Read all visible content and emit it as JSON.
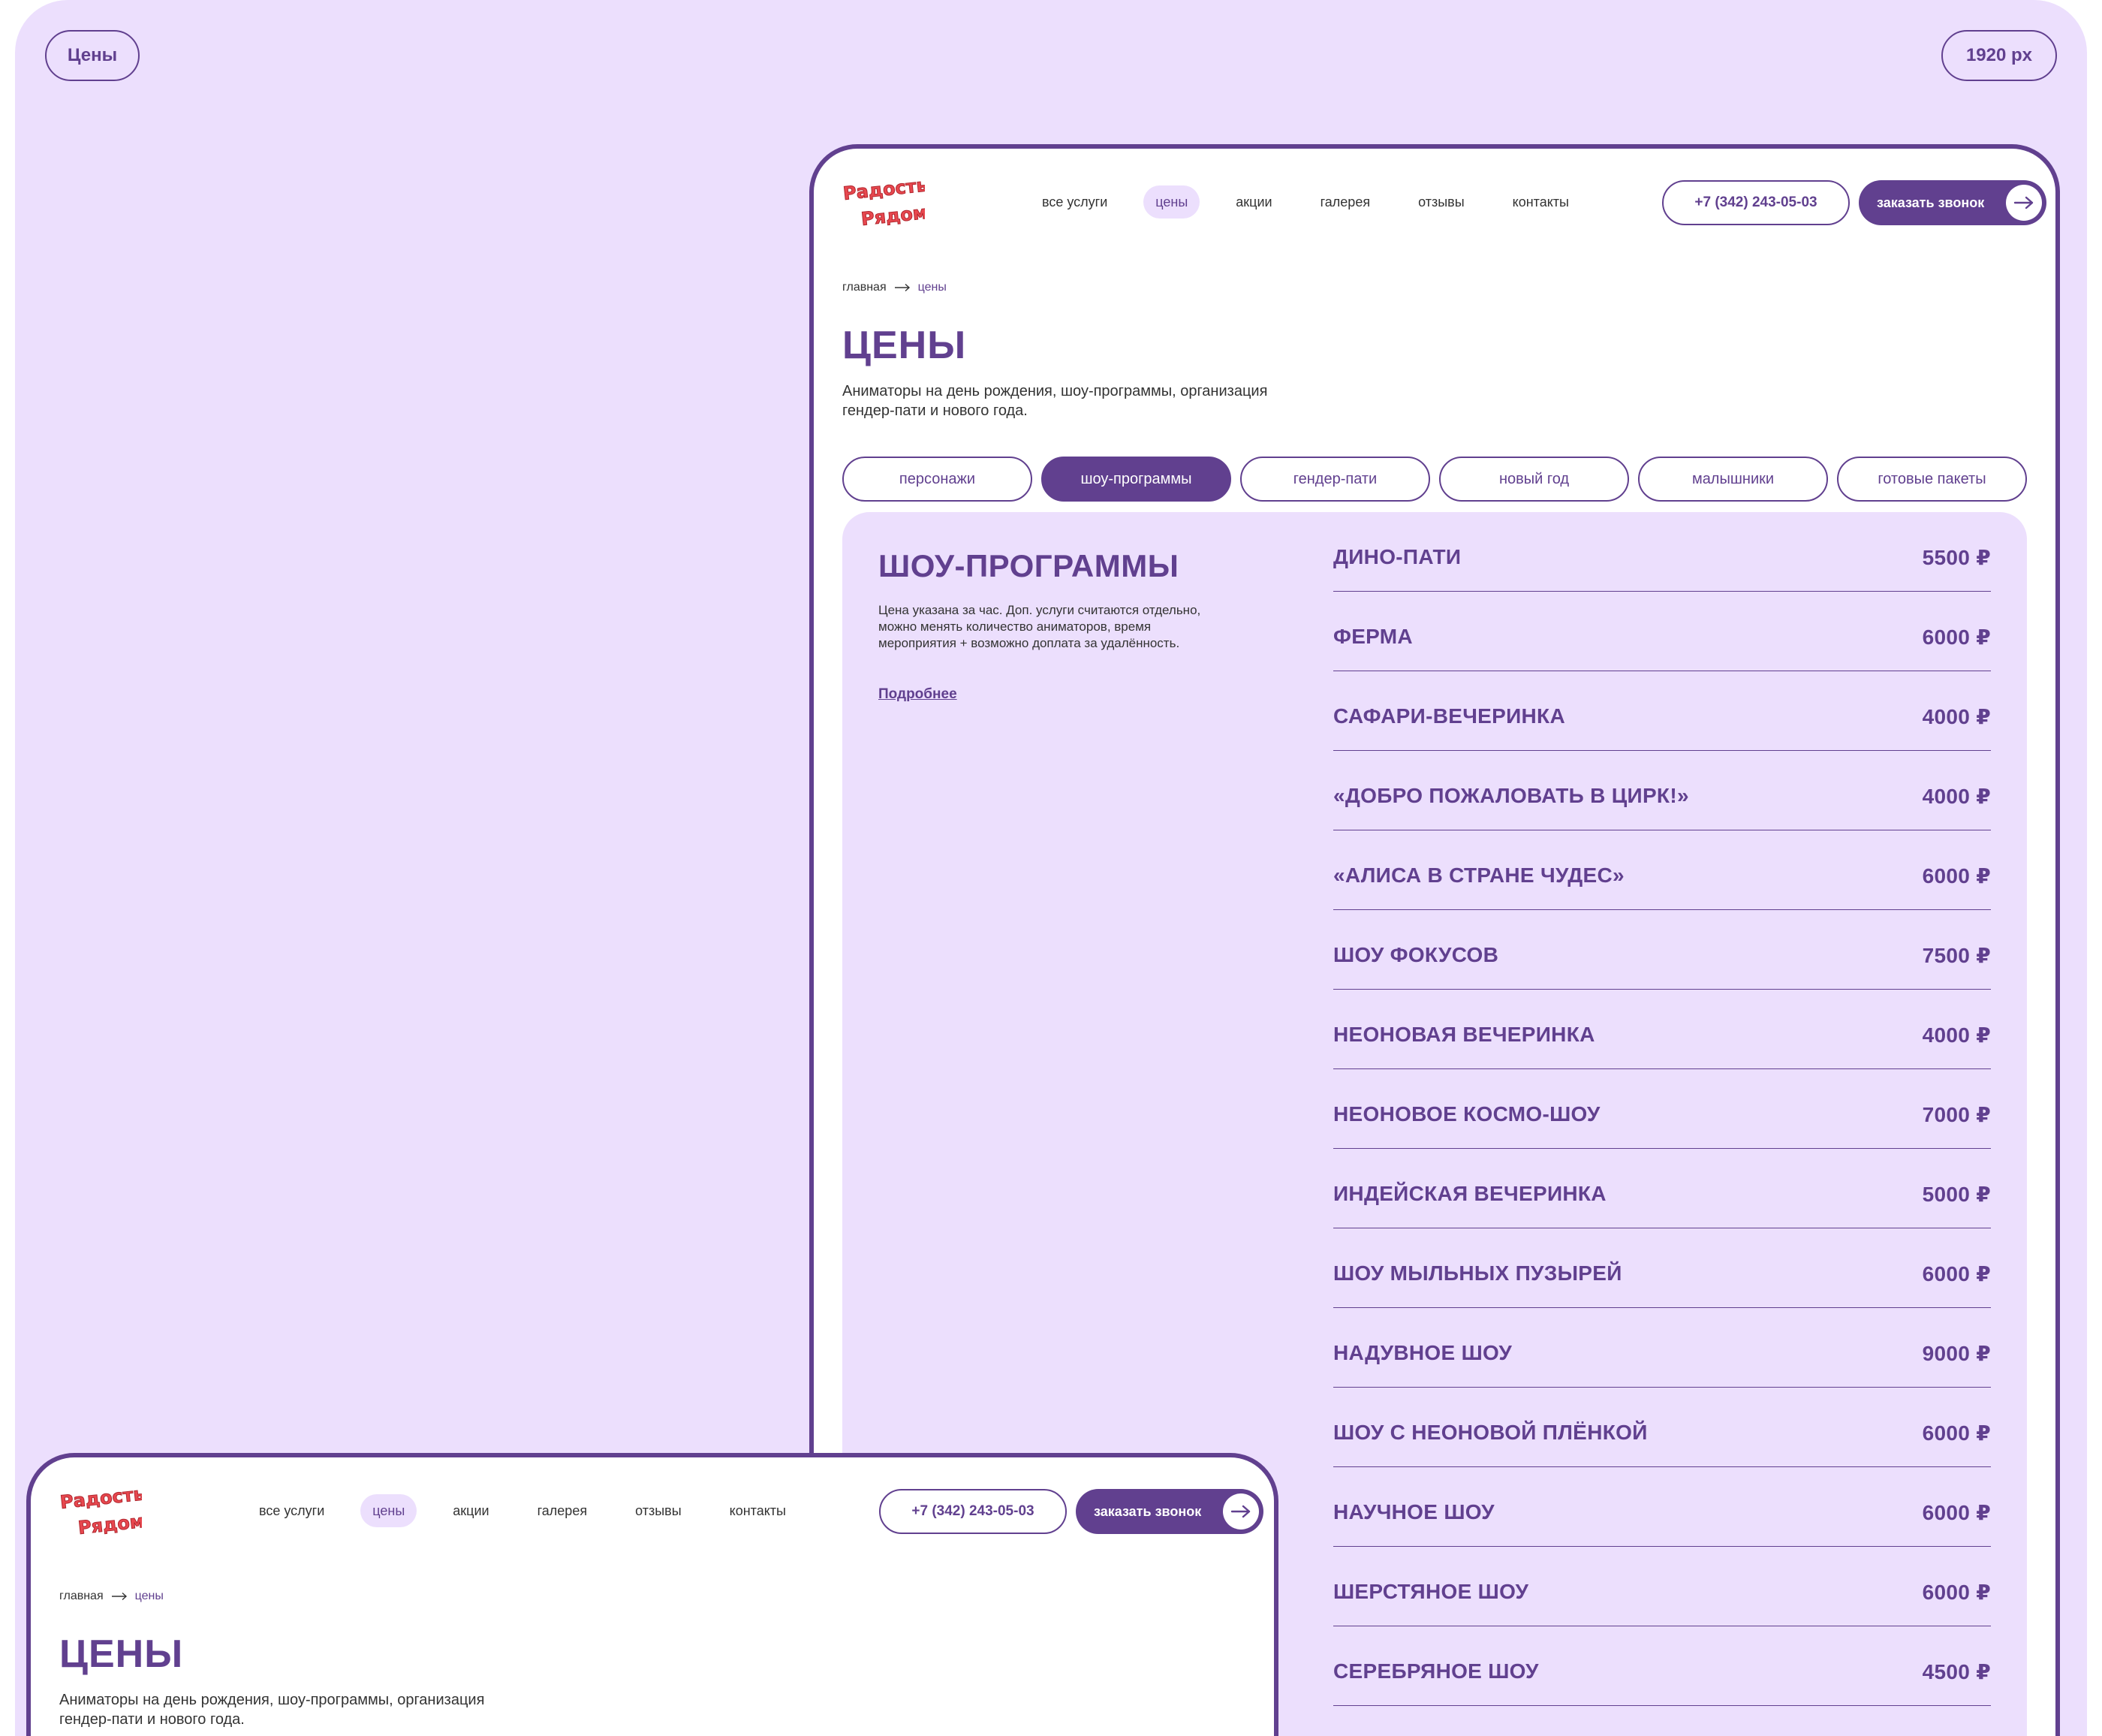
{
  "corner": {
    "left_label": "Цены",
    "right_label": "1920 px"
  },
  "header": {
    "logo_text": "Радость Рядом",
    "nav": [
      "все услуги",
      "цены",
      "акции",
      "галерея",
      "отзывы",
      "контакты"
    ],
    "active_nav": "цены",
    "phone": "+7 (342) 243-05-03",
    "call_label": "заказать звонок"
  },
  "breadcrumb": {
    "home": "главная",
    "current": "цены"
  },
  "page": {
    "title": "ЦЕНЫ",
    "subtitle": "Аниматоры на день рождения, шоу-программы, организация гендер-пати и нового года."
  },
  "tabs": [
    "персонажи",
    "шоу-программы",
    "гендер-пати",
    "новый год",
    "малышники",
    "готовые пакеты"
  ],
  "active_tab": "шоу-программы",
  "panel": {
    "title": "ШОУ-ПРОГРАММЫ",
    "description": "Цена указана за час. Доп. услуги считаются отдельно, можно менять количество аниматоров, время мероприятия + возможно доплата за удалённость.",
    "link": "Подробнее"
  },
  "prices": [
    {
      "name": "ДИНО-ПАТИ",
      "price": "5500 ₽"
    },
    {
      "name": "ФЕРМА",
      "price": "6000 ₽"
    },
    {
      "name": "САФАРИ-ВЕЧЕРИНКА",
      "price": "4000 ₽"
    },
    {
      "name": "«ДОБРО ПОЖАЛОВАТЬ В ЦИРК!»",
      "price": "4000 ₽"
    },
    {
      "name": "«АЛИСА В СТРАНЕ ЧУДЕС»",
      "price": "6000 ₽"
    },
    {
      "name": "ШОУ ФОКУСОВ",
      "price": "7500 ₽"
    },
    {
      "name": "НЕОНОВАЯ ВЕЧЕРИНКА",
      "price": "4000 ₽"
    },
    {
      "name": "НЕОНОВОЕ КОСМО-ШОУ",
      "price": "7000 ₽"
    },
    {
      "name": "ИНДЕЙСКАЯ ВЕЧЕРИНКА",
      "price": "5000 ₽"
    },
    {
      "name": "ШОУ МЫЛЬНЫХ ПУЗЫРЕЙ",
      "price": "6000 ₽"
    },
    {
      "name": "НАДУВНОЕ ШОУ",
      "price": "9000 ₽"
    },
    {
      "name": "ШОУ С НЕОНОВОЙ ПЛЁНКОЙ",
      "price": "6000 ₽"
    },
    {
      "name": "НАУЧНОЕ ШОУ",
      "price": "6000 ₽"
    },
    {
      "name": "ШЕРСТЯНОЕ ШОУ",
      "price": "6000 ₽"
    },
    {
      "name": "СЕРЕБРЯНОЕ ШОУ",
      "price": "4500 ₽"
    }
  ],
  "colors": {
    "accent": "#61408f",
    "background": "#ecdffd",
    "logo_red": "#e8484f",
    "logo_pink": "#f590b4"
  }
}
